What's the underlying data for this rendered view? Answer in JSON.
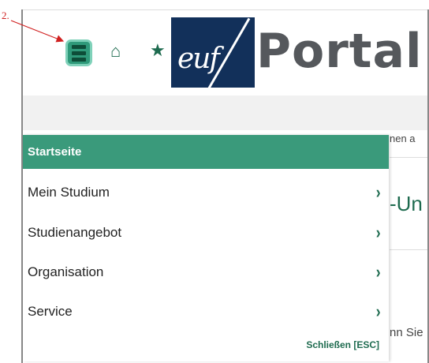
{
  "annotation": {
    "step_label": "2."
  },
  "header": {
    "menu_icon": "menu-icon",
    "home_icon": "home-icon",
    "star_icon": "star-icon",
    "logo_text": "euf",
    "portal_text": "Portal"
  },
  "background": {
    "text_fragment_1": "nen a",
    "heading_fragment": "-Un",
    "text_fragment_2": "nn Sie"
  },
  "side_menu": {
    "items": [
      {
        "label": "Startseite",
        "active": true
      },
      {
        "label": "Mein Studium",
        "chevron": "›"
      },
      {
        "label": "Studienangebot",
        "chevron": "›"
      },
      {
        "label": "Organisation",
        "chevron": "›"
      },
      {
        "label": "Service",
        "chevron": "›"
      }
    ],
    "close_label": "Schließen [ESC]"
  },
  "colors": {
    "accent": "#3a9a7b",
    "icon_green": "#1e6b4f",
    "logo_navy": "#12305a",
    "annotation_red": "#d02020"
  }
}
